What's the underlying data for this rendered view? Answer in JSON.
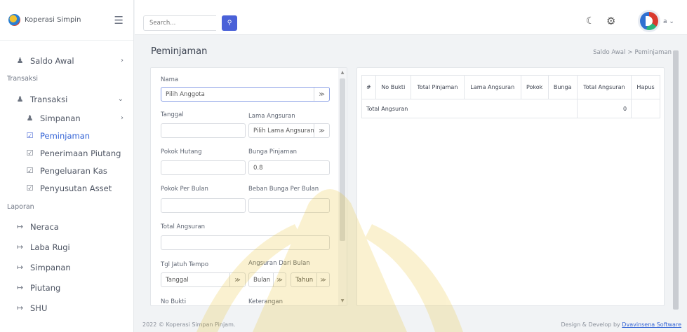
{
  "brand": {
    "name": "Koperasi Simpin"
  },
  "sidebar": {
    "items": [
      {
        "label": "Saldo Awal",
        "icon": "users-icon"
      },
      {
        "section": "Transaksi"
      },
      {
        "label": "Transaksi",
        "icon": "users-icon"
      },
      {
        "label": "Simpanan",
        "icon": "users-icon"
      },
      {
        "label": "Peminjaman",
        "icon": "checkbox-icon",
        "active": true
      },
      {
        "label": "Penerimaan Piutang",
        "icon": "checkbox-icon"
      },
      {
        "label": "Pengeluaran Kas",
        "icon": "checkbox-icon"
      },
      {
        "label": "Penyusutan Asset",
        "icon": "checkbox-icon"
      },
      {
        "section": "Laporan"
      },
      {
        "label": "Neraca",
        "icon": "logout-icon"
      },
      {
        "label": "Laba Rugi",
        "icon": "logout-icon"
      },
      {
        "label": "Simpanan",
        "icon": "logout-icon"
      },
      {
        "label": "Piutang",
        "icon": "logout-icon"
      },
      {
        "label": "SHU",
        "icon": "logout-icon"
      }
    ]
  },
  "header": {
    "search_placeholder": "Search...",
    "user_initial": "a"
  },
  "page": {
    "title": "Peminjaman",
    "breadcrumb": [
      "Saldo Awal",
      "Peminjaman"
    ]
  },
  "form": {
    "nama_label": "Nama",
    "nama_value": "Pilih Anggota",
    "tanggal_label": "Tanggal",
    "lama_angsuran_label": "Lama Angsuran",
    "lama_angsuran_value": "Pilih Lama Angsuran",
    "pokok_hutang_label": "Pokok Hutang",
    "bunga_pinjaman_label": "Bunga Pinjaman",
    "bunga_pinjaman_value": "0.8",
    "pokok_per_bulan_label": "Pokok Per Bulan",
    "beban_bunga_label": "Beban Bunga Per Bulan",
    "total_angsuran_label": "Total Angsuran",
    "tgl_jatuh_tempo_label": "Tgl Jatuh Tempo",
    "tgl_jatuh_tempo_value": "Tanggal",
    "angsuran_dari_bulan_label": "Angsuran Dari Bulan",
    "bulan_value": "Bulan",
    "tahun_value": "Tahun",
    "no_bukti_label": "No Bukti",
    "keterangan_label": "Keterangan"
  },
  "table": {
    "headers": [
      "#",
      "No Bukti",
      "Total Pinjaman",
      "Lama Angsuran",
      "Pokok",
      "Bunga",
      "Total Angsuran",
      "Hapus"
    ],
    "total_label": "Total Angsuran",
    "total_value": "0"
  },
  "footer": {
    "left": "2022 © Koperasi Simpan Pinjam.",
    "right_prefix": "Design & Develop by ",
    "right_link": "Dvavinsena Software"
  },
  "colors": {
    "accent": "#4a61d8",
    "active_text": "#3464d6",
    "background": "#f1f3f5"
  }
}
